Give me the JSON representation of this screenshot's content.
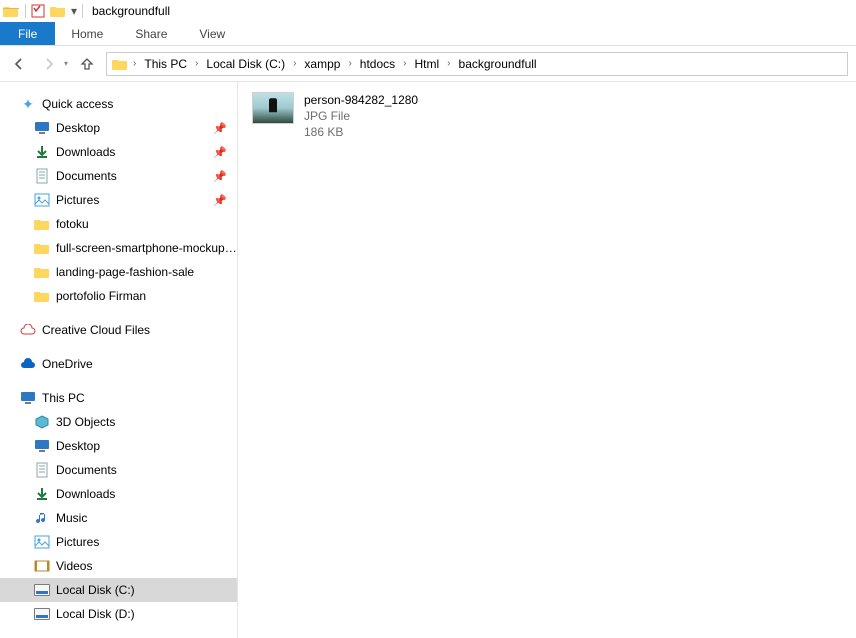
{
  "window": {
    "title": "backgroundfull"
  },
  "ribbon": {
    "file": "File",
    "tabs": [
      "Home",
      "Share",
      "View"
    ]
  },
  "breadcrumbs": [
    "This PC",
    "Local Disk (C:)",
    "xampp",
    "htdocs",
    "Html",
    "backgroundfull"
  ],
  "sidebar": {
    "quick_access": "Quick access",
    "quick_items": [
      {
        "label": "Desktop",
        "icon": "desktop",
        "pinned": true
      },
      {
        "label": "Downloads",
        "icon": "downloads",
        "pinned": true
      },
      {
        "label": "Documents",
        "icon": "documents",
        "pinned": true
      },
      {
        "label": "Pictures",
        "icon": "pictures",
        "pinned": true
      },
      {
        "label": "fotoku",
        "icon": "folder",
        "pinned": false
      },
      {
        "label": "full-screen-smartphone-mockup-design",
        "icon": "folder",
        "pinned": false
      },
      {
        "label": "landing-page-fashion-sale",
        "icon": "folder",
        "pinned": false
      },
      {
        "label": "portofolio Firman",
        "icon": "folder",
        "pinned": false
      }
    ],
    "creative_cloud": "Creative Cloud Files",
    "onedrive": "OneDrive",
    "this_pc": "This PC",
    "pc_items": [
      {
        "label": "3D Objects",
        "icon": "3d"
      },
      {
        "label": "Desktop",
        "icon": "desktop"
      },
      {
        "label": "Documents",
        "icon": "documents"
      },
      {
        "label": "Downloads",
        "icon": "downloads"
      },
      {
        "label": "Music",
        "icon": "music"
      },
      {
        "label": "Pictures",
        "icon": "pictures"
      },
      {
        "label": "Videos",
        "icon": "videos"
      },
      {
        "label": "Local Disk (C:)",
        "icon": "disk",
        "active": true
      },
      {
        "label": "Local Disk (D:)",
        "icon": "disk"
      }
    ]
  },
  "files": [
    {
      "name": "person-984282_1280",
      "type": "JPG File",
      "size": "186 KB"
    }
  ]
}
